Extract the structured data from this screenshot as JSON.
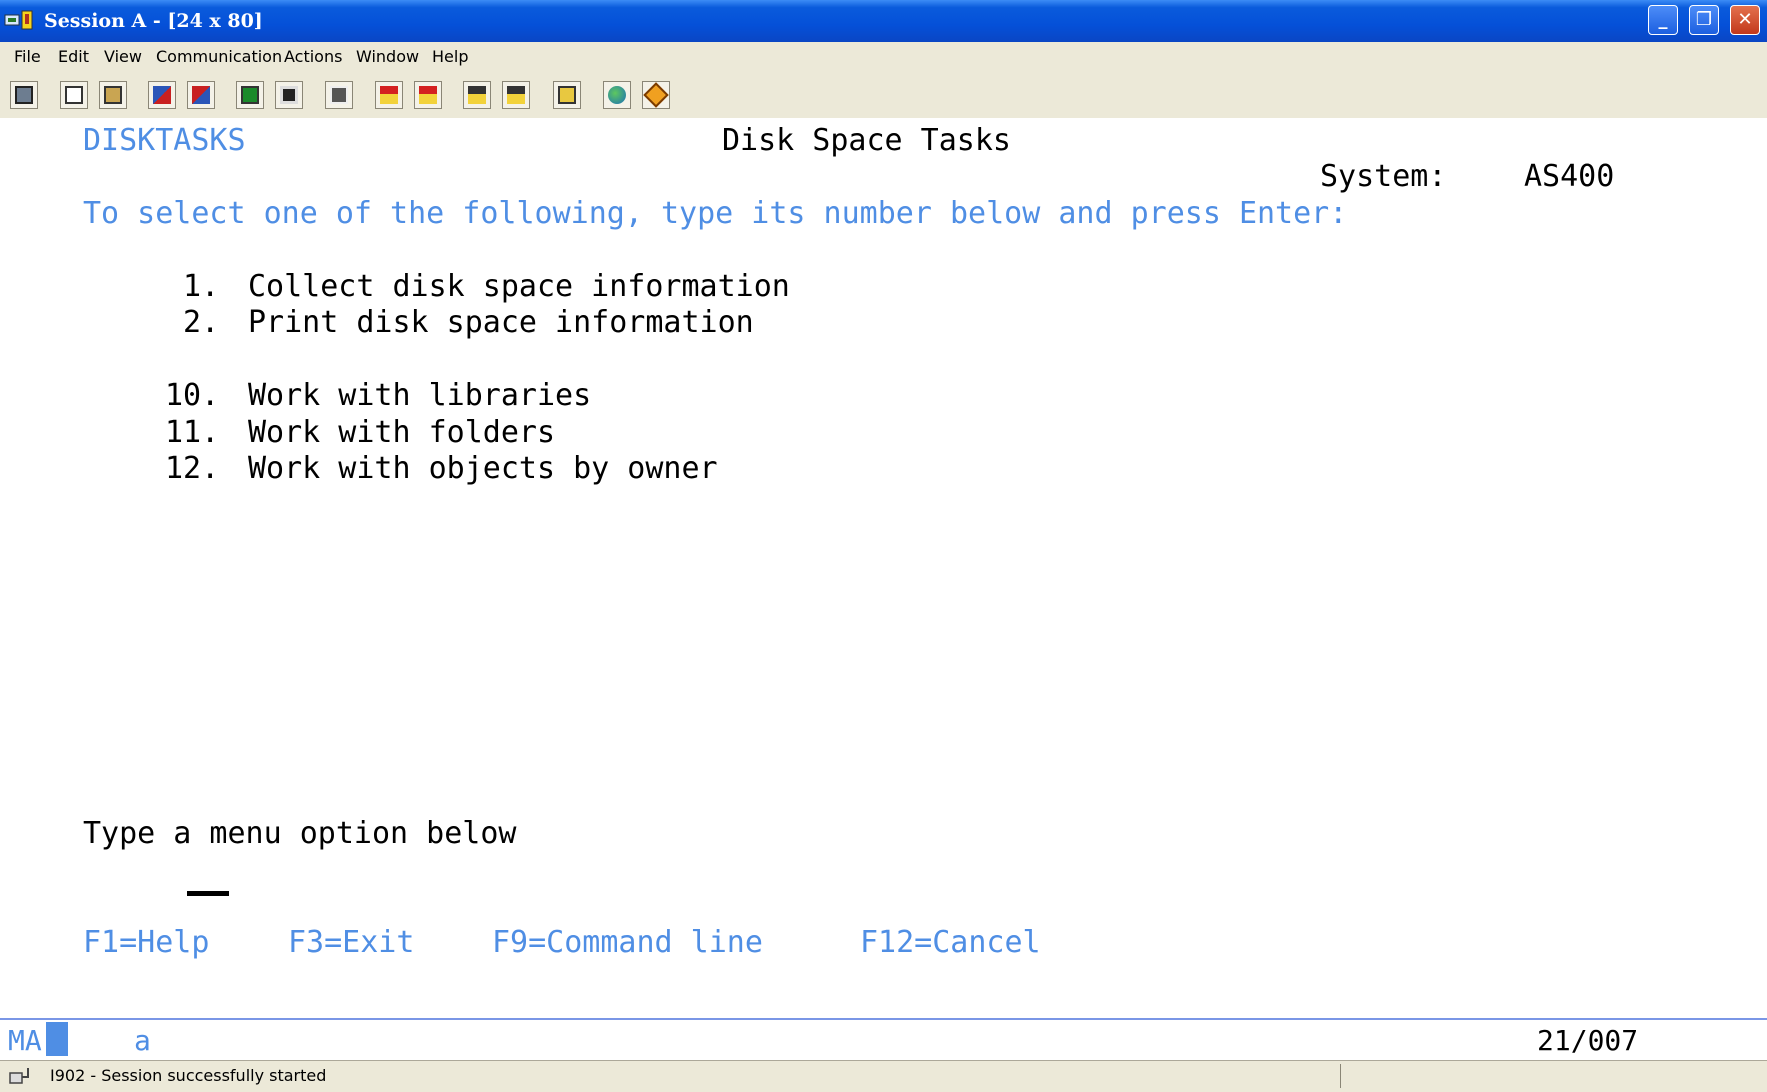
{
  "window": {
    "title": "Session A - [24 x 80]",
    "controls": {
      "minimize": "_",
      "maximize": "❐",
      "close": "✕"
    }
  },
  "menu": [
    "File",
    "Edit",
    "View",
    "Communication",
    "Actions",
    "Window",
    "Help"
  ],
  "toolbar": {
    "icons": [
      "print-screen-icon",
      "copy-icon",
      "paste-icon",
      "send-file-icon",
      "receive-file-icon",
      "display-icon",
      "keyboard-map-icon",
      "macro-icon",
      "record-macro-icon",
      "stop-macro-icon",
      "play-macro-icon",
      "play-macro-2-icon",
      "clipboard-icon",
      "globe-icon",
      "link-icon"
    ]
  },
  "screen": {
    "menu_name": "DISKTASKS",
    "title": "Disk Space Tasks",
    "system_label": "System:",
    "system_value": "AS400",
    "instruction": "To select one of the following, type its number below and press Enter:",
    "options": [
      {
        "num": " 1.",
        "text": "Collect disk space information"
      },
      {
        "num": " 2.",
        "text": "Print disk space information"
      },
      {
        "num": "10.",
        "text": "Work with libraries"
      },
      {
        "num": "11.",
        "text": "Work with folders"
      },
      {
        "num": "12.",
        "text": "Work with objects by owner"
      }
    ],
    "prompt": "Type a menu option below",
    "fkeys": [
      "F1=Help",
      "F3=Exit",
      "F9=Command line",
      "F12=Cancel"
    ]
  },
  "oia": {
    "mode": "MA",
    "indicator": "a",
    "cursor_position": "21/007"
  },
  "status": {
    "message": "I902 - Session successfully started"
  },
  "colors": {
    "field_blue": "#4f8ee4",
    "text_black": "#000000",
    "titlebar": "#0550d8"
  }
}
